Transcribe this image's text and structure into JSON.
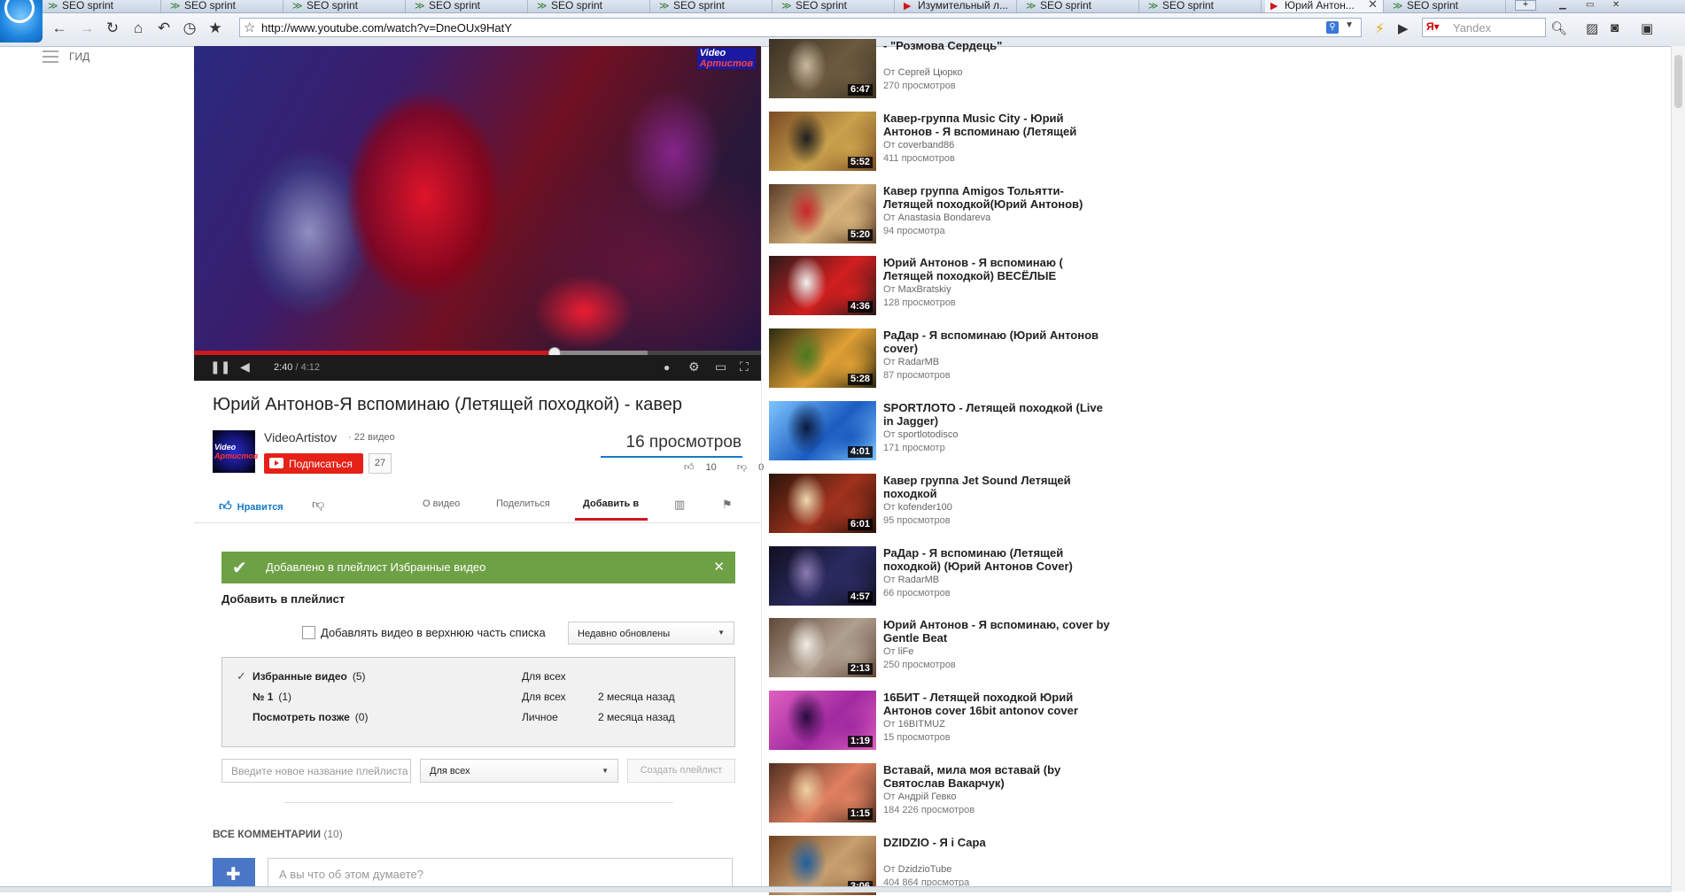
{
  "browser": {
    "tabs": [
      {
        "label": "SEO sprint",
        "favicon": "seo-sprint-icon",
        "active": false
      },
      {
        "label": "SEO sprint",
        "favicon": "seo-sprint-icon",
        "active": false
      },
      {
        "label": "SEO sprint",
        "favicon": "seo-sprint-icon",
        "active": false
      },
      {
        "label": "SEO sprint",
        "favicon": "seo-sprint-icon",
        "active": false
      },
      {
        "label": "SEO sprint",
        "favicon": "seo-sprint-icon",
        "active": false
      },
      {
        "label": "SEO sprint",
        "favicon": "seo-sprint-icon",
        "active": false
      },
      {
        "label": "SEO sprint",
        "favicon": "seo-sprint-icon",
        "active": false
      },
      {
        "label": "Изумительный л...",
        "favicon": "youtube-icon",
        "active": false
      },
      {
        "label": "SEO sprint",
        "favicon": "seo-sprint-icon",
        "active": false
      },
      {
        "label": "SEO sprint",
        "favicon": "seo-sprint-icon",
        "active": false
      },
      {
        "label": "Юрий Антон...",
        "favicon": "youtube-icon",
        "active": true
      },
      {
        "label": "SEO sprint",
        "favicon": "seo-sprint-icon",
        "active": false
      }
    ],
    "newtab_label": "+",
    "url": "http://www.youtube.com/watch?v=DneOUx9HatY",
    "search_placeholder": "Yandex"
  },
  "guide": {
    "label": "ГИД"
  },
  "player": {
    "current_time": "2:40",
    "separator": " / ",
    "duration": "4:12",
    "progress": 0.635,
    "buffered": 0.8,
    "watermark_a": "Video",
    "watermark_b": "Артистов"
  },
  "video": {
    "title": "Юрий Антонов-Я вспоминаю (Летящей походкой) - кавер",
    "channel_name": "VideoArtistov",
    "channel_videos": "· 22 видео",
    "subscribe_label": "Подписаться",
    "subscriber_count": "27",
    "views": "16 просмотров",
    "likes": "10",
    "dislikes": "0"
  },
  "actions": {
    "like_label": "Нравится",
    "tabs": [
      "О видео",
      "Поделиться",
      "Добавить в"
    ]
  },
  "add_to": {
    "banner": "Добавлено в плейлист Избранные видео",
    "heading": "Добавить в плейлист",
    "add_top_label": "Добавлять видео в верхнюю часть списка",
    "sort_value": "Недавно обновлены",
    "playlists": [
      {
        "name": "Избранные видео",
        "count": "(5)",
        "privacy": "Для всех",
        "updated": "",
        "checked": true
      },
      {
        "name": "№ 1",
        "count": "(1)",
        "privacy": "Для всех",
        "updated": "2 месяца назад",
        "checked": false
      },
      {
        "name": "Посмотреть позже",
        "count": "(0)",
        "privacy": "Личное",
        "updated": "2 месяца назад",
        "checked": false
      }
    ],
    "new_playlist_placeholder": "Введите новое название плейлиста",
    "new_playlist_privacy": "Для всех",
    "create_label": "Создать плейлист"
  },
  "comments": {
    "heading": "ВСЕ КОММЕНТАРИИ",
    "count": "(10)",
    "placeholder": "А вы что об этом думаете?"
  },
  "related": [
    {
      "title": "- \"Розмова Сердець\"",
      "channel": "Сергей Цюрко",
      "views": "270 просмотров",
      "duration": "6:47",
      "colors": [
        "#6b5a3e",
        "#c8b9a0",
        "#3d3324"
      ]
    },
    {
      "title": "Кавер-группа Music City - Юрий Антонов - Я вспоминаю (Летящей",
      "channel": "coverband86",
      "views": "411 просмотров",
      "duration": "5:52",
      "colors": [
        "#c9a24c",
        "#1f1f1f",
        "#7a4a23"
      ]
    },
    {
      "title": "Кавер группа Amigos Тольятти- Летящей походкой(Юрий Антонов)",
      "channel": "Anastasia Bondareva",
      "views": "94 просмотра",
      "duration": "5:20",
      "colors": [
        "#d7b37a",
        "#c9262a",
        "#5a3b28"
      ]
    },
    {
      "title": "Юрий Антонов - Я вспоминаю ( Летящей походкой) ВЕСЁЛЫЕ",
      "channel": "MaxBratskiy",
      "views": "128 просмотров",
      "duration": "4:36",
      "colors": [
        "#d21e1e",
        "#f1f1f1",
        "#2a1a1a"
      ]
    },
    {
      "title": "РаДар - Я вспоминаю (Юрий Антонов cover)",
      "channel": "RadarMB",
      "views": "87 просмотров",
      "duration": "5:28",
      "colors": [
        "#e0a035",
        "#4a7a20",
        "#2a2a10"
      ]
    },
    {
      "title": "SPORTЛОТО - Летящей походкой (Live in Jagger)",
      "channel": "sportlotodisco",
      "views": "171 просмотр",
      "duration": "4:01",
      "colors": [
        "#1a5cc0",
        "#0a1a40",
        "#7fc6ff"
      ]
    },
    {
      "title": "Кавер группа Jet Sound Летящей походкой",
      "channel": "kofender100",
      "views": "95 просмотров",
      "duration": "6:01",
      "colors": [
        "#a0321e",
        "#f0d9b0",
        "#2a1408"
      ]
    },
    {
      "title": "РаДар - Я вспоминаю (Летящей походкой) (Юрий Антонов Cover)",
      "channel": "RadarMB",
      "views": "66 просмотров",
      "duration": "4:57",
      "colors": [
        "#2a2a60",
        "#8a7ab0",
        "#101020"
      ]
    },
    {
      "title": "Юрий Антонов - Я вспоминаю, cover by Gentle Beat",
      "channel": "liFe",
      "views": "250 просмотров",
      "duration": "2:13",
      "colors": [
        "#b0a090",
        "#f0ece4",
        "#604838"
      ]
    },
    {
      "title": "16БИТ - Летящей походкой Юрий Антонов cover 16bit antonov cover",
      "channel": "16BITMUZ",
      "views": "15 просмотров",
      "duration": "1:19",
      "colors": [
        "#a02aa0",
        "#2a0a40",
        "#e060c0"
      ]
    },
    {
      "title": "Вставай, мила моя вставай (by Святослав Вакарчук)",
      "channel": "Андрій Гевко",
      "views": "184 226 просмотров",
      "duration": "1:15",
      "colors": [
        "#e08060",
        "#f0d0a0",
        "#503020"
      ]
    },
    {
      "title": "DZIDZIO - Я і Сара",
      "channel": "DzidzioTube",
      "views": "404 864 просмотра",
      "duration": "3:06",
      "colors": [
        "#c8a070",
        "#2060a0",
        "#704020"
      ]
    }
  ],
  "related_from_label": "От"
}
